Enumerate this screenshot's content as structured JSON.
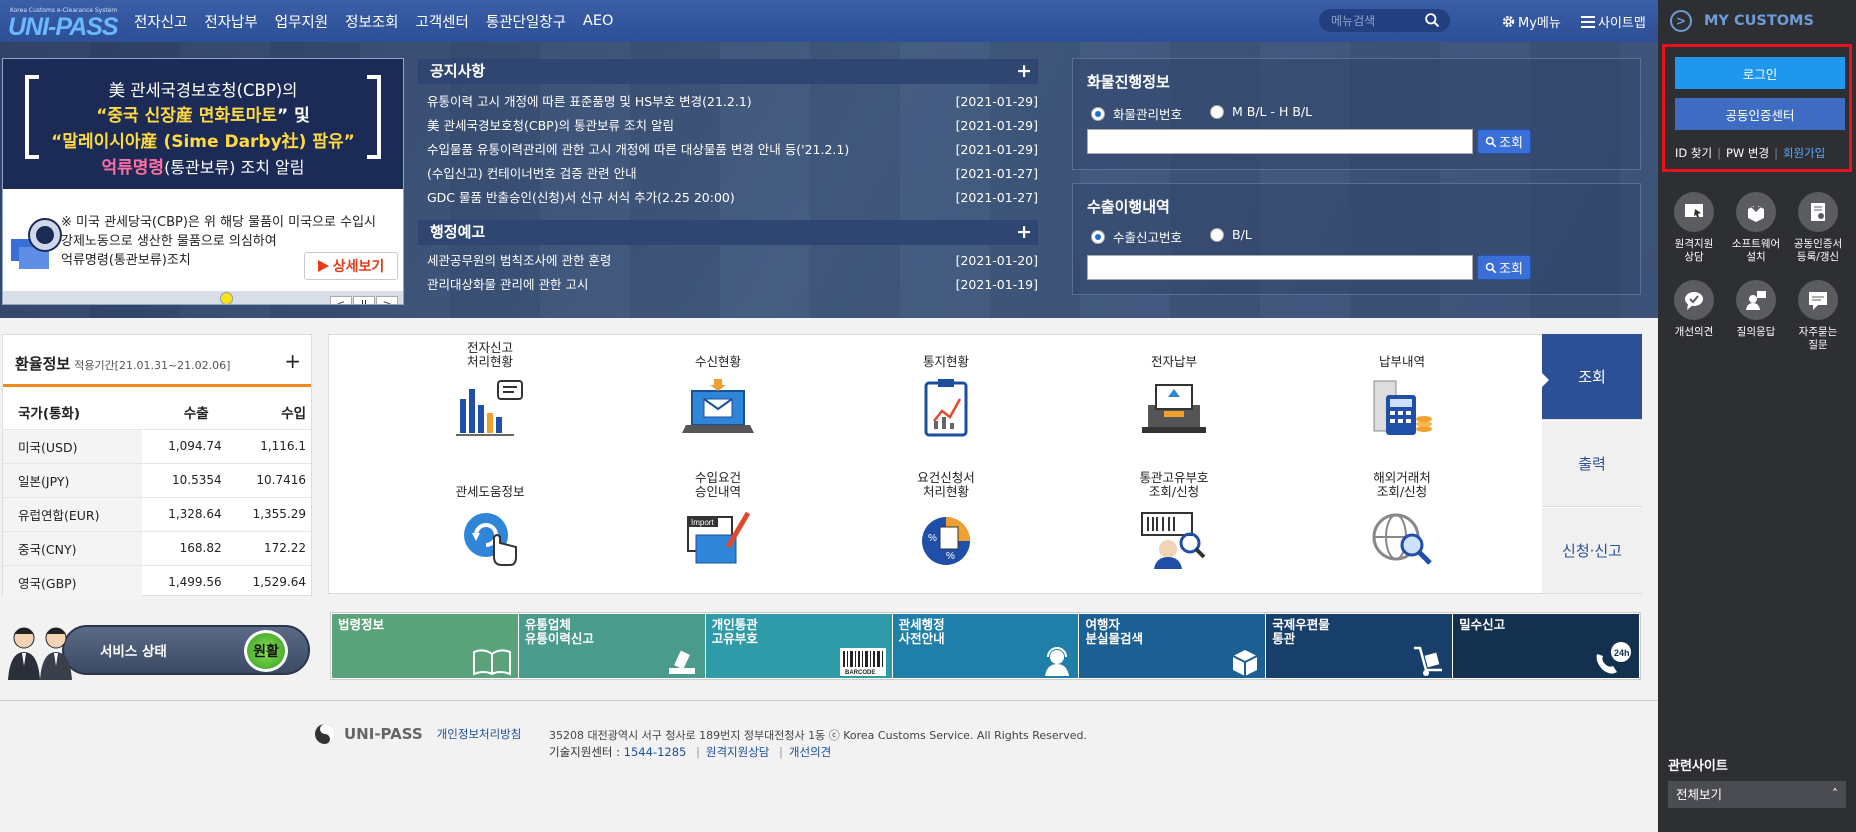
{
  "header": {
    "logo": "UNI-PASS",
    "logo_sub": "Korea Customs e-Clearance System",
    "nav": [
      "전자신고",
      "전자납부",
      "업무지원",
      "정보조회",
      "고객센터",
      "통관단일창구",
      "AEO"
    ],
    "menu_search_placeholder": "메뉴검색",
    "my_menu": "My메뉴",
    "sitemap": "사이트맵"
  },
  "banner": {
    "line1": "美 관세국경보호청(CBP)의",
    "line2a": "“중국 신장産 면화토마토",
    "line2b": "” 및",
    "line3": "“말레이시아産 (Sime Darby社) 팜유”",
    "line4a": "억류명령",
    "line4b": "(통관보류) 조치 알림",
    "desc": [
      "※ 미국 관세당국(CBP)은 위 해당 물품이 미국으로 수입시",
      "강제노동으로 생산한 물품으로 의심하여",
      "억류명령(통관보류)조치"
    ],
    "more": "상세보기",
    "prev": "<",
    "pause": "II",
    "next": ">"
  },
  "notices": {
    "title": "공지사항",
    "plus": "+",
    "items": [
      {
        "text": "유통이력 고시 개정에 따른 표준품명 및 HS부호 변경(21.2.1)",
        "date": "[2021-01-29]"
      },
      {
        "text": "美 관세국경보호청(CBP)의 통관보류 조치 알림",
        "date": "[2021-01-29]"
      },
      {
        "text": "수입물품 유통이력관리에 관한 고시 개정에 따른 대상물품 변경 안내 등('21.2.1)",
        "date": "[2021-01-29]"
      },
      {
        "text": "(수입신고) 컨테이너번호 검증 관련 안내",
        "date": "[2021-01-27]"
      },
      {
        "text": "GDC 물품 반출승인(신청)서 신규 서식 추가(2.25 20:00)",
        "date": "[2021-01-27]"
      }
    ]
  },
  "admin_notices": {
    "title": "행정예고",
    "plus": "+",
    "items": [
      {
        "text": "세관공무원의 범칙조사에 관한 훈령",
        "date": "[2021-01-20]"
      },
      {
        "text": "관리대상화물 관리에 관한 고시",
        "date": "[2021-01-19]"
      }
    ]
  },
  "cargo": {
    "title": "화물진행정보",
    "opt1": "화물관리번호",
    "opt2": "M B/L - H B/L",
    "btn": "조회",
    "value": ""
  },
  "export": {
    "title": "수출이행내역",
    "opt1": "수출신고번호",
    "opt2": "B/L",
    "btn": "조회",
    "value": ""
  },
  "exchange": {
    "title": "환율정보",
    "period": "적용기간[21.01.31~21.02.06]",
    "plus": "+",
    "headers": [
      "국가(통화)",
      "수출",
      "수입"
    ],
    "rows": [
      [
        "미국(USD)",
        "1,094.74",
        "1,116.1"
      ],
      [
        "일본(JPY)",
        "10.5354",
        "10.7416"
      ],
      [
        "유럽연합(EUR)",
        "1,328.64",
        "1,355.29"
      ],
      [
        "중국(CNY)",
        "168.82",
        "172.22"
      ],
      [
        "영국(GBP)",
        "1,499.56",
        "1,529.64"
      ]
    ]
  },
  "service": {
    "label": "서비스 상태",
    "status": "원활"
  },
  "services": [
    "전자신고\n처리현황",
    "수신현황",
    "통지현황",
    "전자납부",
    "납부내역",
    "관세도움정보",
    "수입요건\n승인내역",
    "요건신청서\n처리현황",
    "통관고유부호\n조회/신청",
    "해외거래처\n조회/신청"
  ],
  "tabs": [
    "조회",
    "출력",
    "신청·신고"
  ],
  "quicklinks": [
    {
      "label": "법령정보",
      "color": "#5aa37a"
    },
    {
      "label": "유통업체\n유통이력신고",
      "color": "#4b9b8c"
    },
    {
      "label": "개인통관\n고유부호",
      "color": "#2f9aa8"
    },
    {
      "label": "관세행정\n사전안내",
      "color": "#1f7fa8"
    },
    {
      "label": "여행자\n분실물검색",
      "color": "#1c5f92"
    },
    {
      "label": "국제우편물\n통관",
      "color": "#183f6a"
    },
    {
      "label": "밀수신고",
      "color": "#14304f"
    }
  ],
  "footer": {
    "logo": "UNI-PASS",
    "privacy": "개인정보처리방침",
    "address": "35208 대전광역시 서구 청사로 189번지 정부대전청사 1동 ⓒ Korea Customs Service. All Rights Reserved.",
    "tech_label": "기술지원센터 : ",
    "tech_phone": "1544-1285",
    "remote": "원격지원상담",
    "feedback": "개선의견"
  },
  "side": {
    "title": "MY CUSTOMS",
    "login": "로그인",
    "cert": "공동인증센터",
    "id_find": "ID 찾기",
    "pw_change": "PW 변경",
    "join": "회원가입",
    "icons": [
      "원격지원\n상담",
      "소프트웨어\n설치",
      "공동인증서\n등록/갱신",
      "개선의견",
      "질의응답",
      "자주묻는\n질문"
    ],
    "related": "관련사이트",
    "related_select": "전체보기"
  }
}
